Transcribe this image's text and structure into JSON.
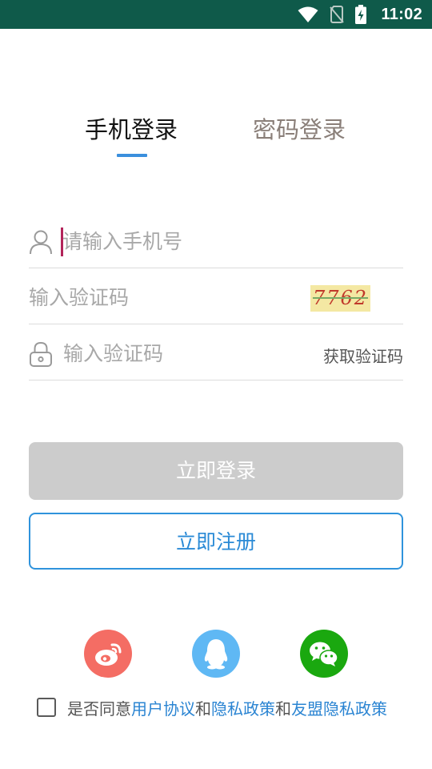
{
  "status_bar": {
    "time": "11:02",
    "icons": [
      "wifi-icon",
      "no-sim-icon",
      "battery-charging-icon"
    ],
    "background": "#0f5a4a"
  },
  "tabs": [
    {
      "label": "手机登录",
      "active": true
    },
    {
      "label": "密码登录",
      "active": false
    }
  ],
  "form": {
    "phone_placeholder": "请输入手机号",
    "captcha_placeholder": "输入验证码",
    "captcha_text": "7762",
    "code_placeholder": "输入验证码",
    "get_code_label": "获取验证码"
  },
  "buttons": {
    "login_label": "立即登录",
    "register_label": "立即注册"
  },
  "social": [
    "weibo-icon",
    "qq-icon",
    "wechat-icon"
  ],
  "agreement": {
    "prefix": "是否同意",
    "user_agreement": "用户协议",
    "and1": "和",
    "privacy_policy": "隐私政策",
    "and2": "和",
    "union_privacy": "友盟隐私政策",
    "checked": false
  },
  "colors": {
    "accent": "#2f93dc",
    "disabled_button": "#cccccc",
    "weibo": "#f46d64",
    "qq": "#5fb8f4",
    "wechat": "#1aa80f"
  }
}
